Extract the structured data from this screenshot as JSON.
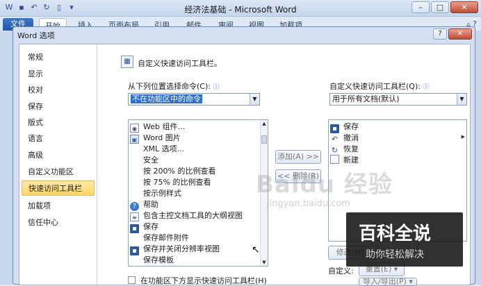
{
  "window": {
    "title": "经济法基础 - Microsoft Word",
    "controls": [
      "–",
      "□",
      "✕"
    ]
  },
  "ribbon": {
    "file_tab": "文件",
    "tabs": [
      "开始",
      "插入",
      "页面布局",
      "引用",
      "邮件",
      "审阅",
      "视图",
      "加载项"
    ]
  },
  "dialog": {
    "title": "Word 选项",
    "help": "?",
    "close": "✕",
    "nav": [
      "常规",
      "显示",
      "校对",
      "保存",
      "版式",
      "语言",
      "高级",
      "自定义功能区",
      "快速访问工具栏",
      "加载项",
      "信任中心"
    ],
    "selected_nav": "快速访问工具栏",
    "header": "自定义快速访问工具栏。",
    "choose_label": "从下列位置选择命令(C):",
    "choose_value": "不在功能区中的命令",
    "customize_label": "自定义快速访问工具栏(Q):",
    "customize_value": "用于所有文档(默认)",
    "commands": [
      {
        "icon": "web-icon",
        "label": "Web 组件..."
      },
      {
        "icon": "picture-icon",
        "label": "Word 图片"
      },
      {
        "icon": "blank",
        "label": "XML 选项..."
      },
      {
        "icon": "blank",
        "label": "安全"
      },
      {
        "icon": "blank",
        "label": "按 200% 的比例查看"
      },
      {
        "icon": "blank",
        "label": "按 75% 的比例查看"
      },
      {
        "icon": "blank",
        "label": "按示例样式"
      },
      {
        "icon": "help-icon",
        "label": "帮助"
      },
      {
        "icon": "document-icon",
        "label": "包含主控文档工具的大纲视图"
      },
      {
        "icon": "save-icon",
        "label": "保存"
      },
      {
        "icon": "blank",
        "label": "保存邮件附件"
      },
      {
        "icon": "save-icon",
        "label": "保存并关闭分辨率视图"
      },
      {
        "icon": "blank",
        "label": "保存模板"
      }
    ],
    "qat_items": [
      {
        "icon": "save-icon",
        "label": "保存"
      },
      {
        "icon": "undo-icon",
        "label": "撤消"
      },
      {
        "icon": "redo-icon",
        "label": "恢复"
      },
      {
        "icon": "new-document-icon",
        "label": "新建"
      }
    ],
    "add_button": "添加(A) >>",
    "remove_button": "<< 删除(R)",
    "modify_button": "修改(M)...",
    "customize_row_label": "自定义:",
    "reset_button": "重置(E) ▾",
    "import_export_button": "导入/导出(P) ▾",
    "below_ribbon_checkbox": "在功能区下方显示快速访问工具栏(H)"
  },
  "watermark": {
    "baidu": "Baidu 经验",
    "url": "jingyan.baidu.com",
    "badge_title": "百科全说",
    "badge_sub": "助你轻松解决"
  }
}
